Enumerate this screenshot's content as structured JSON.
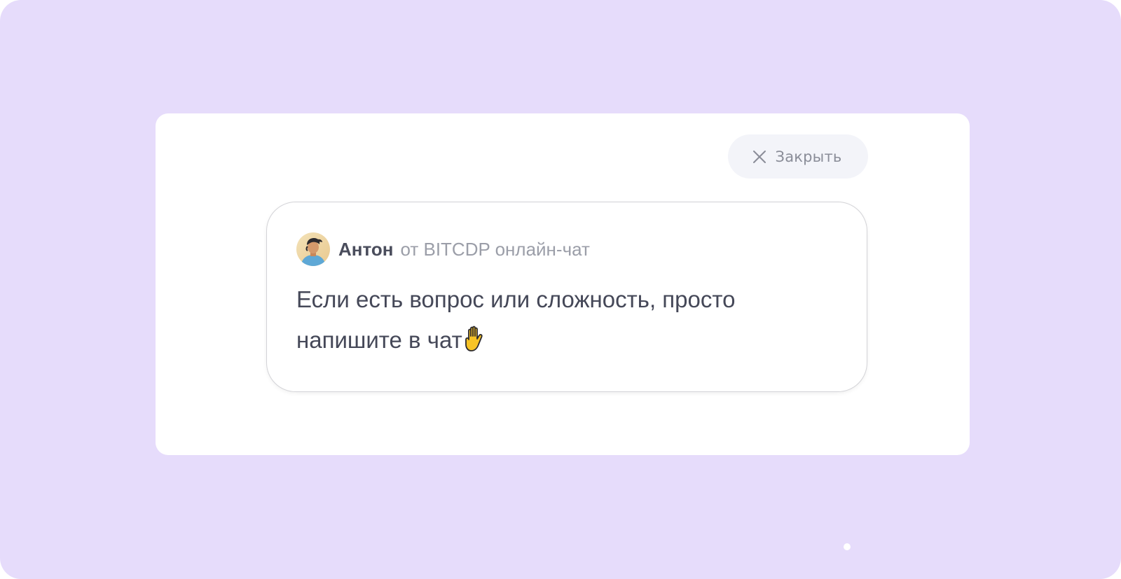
{
  "popup": {
    "close_label": "Закрыть",
    "close_icon": "close-icon"
  },
  "chat": {
    "author_name": "Антон",
    "author_meta": "от BITCDP онлайн-чат",
    "avatar_icon": "avatar",
    "message_text": "Если есть вопрос или сложность, просто напишите в чат",
    "message_emoji": "raised-hand-icon"
  },
  "colors": {
    "background": "#e6dcfb",
    "panel": "#ffffff",
    "close_button_bg": "#f3f4f9",
    "text_primary": "#454858",
    "text_secondary": "#9b9ea8"
  }
}
